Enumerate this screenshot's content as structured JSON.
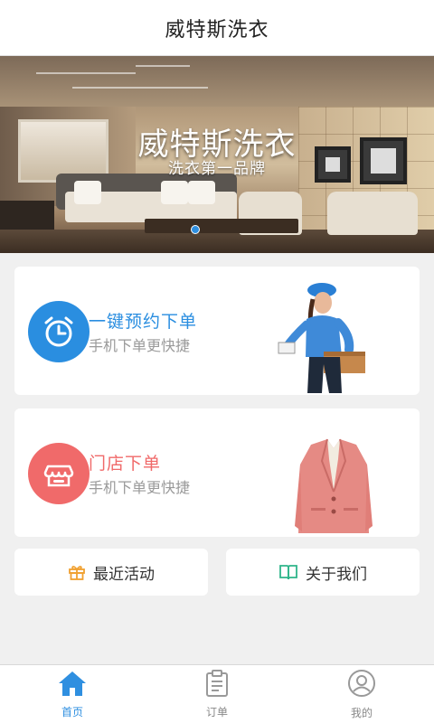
{
  "header": {
    "title": "威特斯洗衣"
  },
  "banner": {
    "title": "威特斯洗衣",
    "subtitle": "洗衣第一品牌"
  },
  "cards": [
    {
      "title": "一键预约下单",
      "subtitle": "手机下单更快捷",
      "color": "#2a8ee0",
      "icon": "alarm-clock-icon"
    },
    {
      "title": "门店下单",
      "subtitle": "手机下单更快捷",
      "color": "#f06a6a",
      "icon": "store-icon"
    }
  ],
  "shortcuts": [
    {
      "label": "最近活动",
      "icon": "gift-icon",
      "color": "#f0a030"
    },
    {
      "label": "关于我们",
      "icon": "book-icon",
      "color": "#2fb58a"
    }
  ],
  "tabbar": {
    "items": [
      {
        "label": "首页",
        "icon": "home-icon",
        "active": true
      },
      {
        "label": "订单",
        "icon": "order-list-icon",
        "active": false
      },
      {
        "label": "我的",
        "icon": "profile-icon",
        "active": false
      }
    ]
  },
  "colors": {
    "accent": "#2f8fe0",
    "background": "#f0f0f0"
  }
}
